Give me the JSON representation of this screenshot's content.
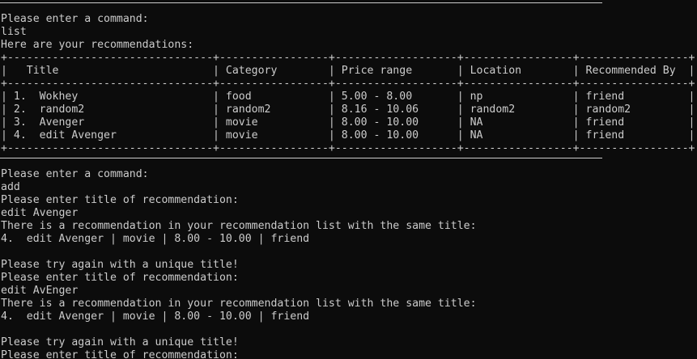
{
  "terminal": {
    "session1": {
      "prompt": "Please enter a command:",
      "input": "list",
      "response": "Here are your recommendations:"
    },
    "table": {
      "border": "+--------------------------------+-----------------+-------------------+-----------------+-----------------+",
      "header": "|   Title                        | Category        | Price range       | Location        | Recommended By  |",
      "rows": [
        "| 1.  Wokhey                     | food            | 5.00 - 8.00       | np              | friend          |",
        "| 2.  random2                    | random2         | 8.16 - 10.06      | random2         | random2         |",
        "| 3.  Avenger                    | movie           | 8.00 - 10.00      | NA              | friend          |",
        "| 4.  edit Avenger               | movie           | 8.00 - 10.00      | NA              | friend          |"
      ]
    },
    "session2": {
      "prompt": "Please enter a command:",
      "input": "add",
      "title_prompt_1": "Please enter title of recommendation:",
      "title_input_1": "edit Avenger",
      "duplicate_msg_1": "There is a recommendation in your recommendation list with the same title:",
      "duplicate_item_1": "4.  edit Avenger | movie | 8.00 - 10.00 | friend",
      "retry_msg_1": "Please try again with a unique title!",
      "title_prompt_2": "Please enter title of recommendation:",
      "title_input_2": "edit AvEnger",
      "duplicate_msg_2": "There is a recommendation in your recommendation list with the same title:",
      "duplicate_item_2": "4.  edit Avenger | movie | 8.00 - 10.00 | friend",
      "retry_msg_2": "Please try again with a unique title!",
      "title_prompt_3": "Please enter title of recommendation:"
    }
  }
}
